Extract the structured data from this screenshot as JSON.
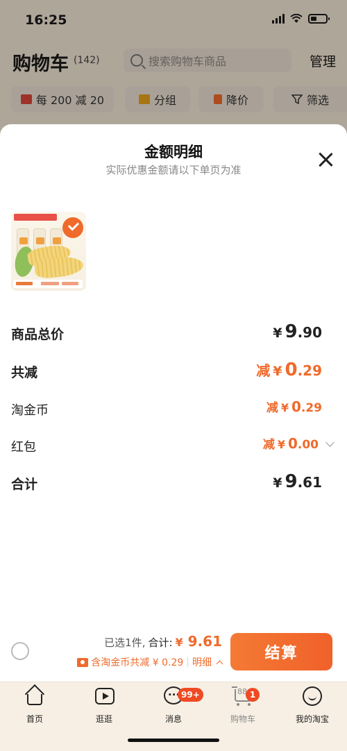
{
  "status_bar": {
    "time": "16:25"
  },
  "header": {
    "title": "购物车",
    "count": "(142)",
    "search_placeholder": "搜索购物车商品",
    "manage": "管理"
  },
  "filters": [
    {
      "label": "每 200 减 20",
      "icon": "shop-icon",
      "color": "#d9463a"
    },
    {
      "label": "分组",
      "icon": "folder-icon",
      "color": "#e8a21a"
    },
    {
      "label": "降价",
      "icon": "price-drop-icon",
      "color": "#ef6a2b"
    },
    {
      "label": "筛选",
      "icon": "filter-icon"
    }
  ],
  "sheet": {
    "title": "金额明细",
    "subtitle": "实际优惠金额请以下单页为准",
    "rows": [
      {
        "label": "商品总价",
        "prefix": "",
        "yen": "¥",
        "int": "9",
        "dec": ".90"
      },
      {
        "label": "共减",
        "prefix": "减",
        "yen": "¥",
        "int": "0",
        "dec": ".29"
      },
      {
        "label": "淘金币",
        "prefix": "减",
        "yen": "¥",
        "int": "0",
        "dec": ".29"
      },
      {
        "label": "红包",
        "prefix": "减",
        "yen": "¥",
        "int": "0",
        "dec": ".00"
      },
      {
        "label": "合计",
        "prefix": "",
        "yen": "¥",
        "int": "9",
        "dec": ".61"
      }
    ]
  },
  "checkout": {
    "selected_text": "已选1件,",
    "total_label": "合计:",
    "total_currency": "¥",
    "total_value": "9.61",
    "coin_text": "含淘金币共减 ¥ 0.29",
    "detail_link": "明细",
    "button": "结算"
  },
  "tabs": [
    {
      "label": "首页",
      "icon": "home-icon"
    },
    {
      "label": "逛逛",
      "icon": "video-icon"
    },
    {
      "label": "消息",
      "icon": "message-icon",
      "badge": "99+"
    },
    {
      "label": "购物车",
      "icon": "cart-icon",
      "badge": "1",
      "cart_count": "88"
    },
    {
      "label": "我的淘宝",
      "icon": "profile-icon"
    }
  ],
  "colors": {
    "accent": "#ef6a2b",
    "badge": "#ef4a23"
  }
}
